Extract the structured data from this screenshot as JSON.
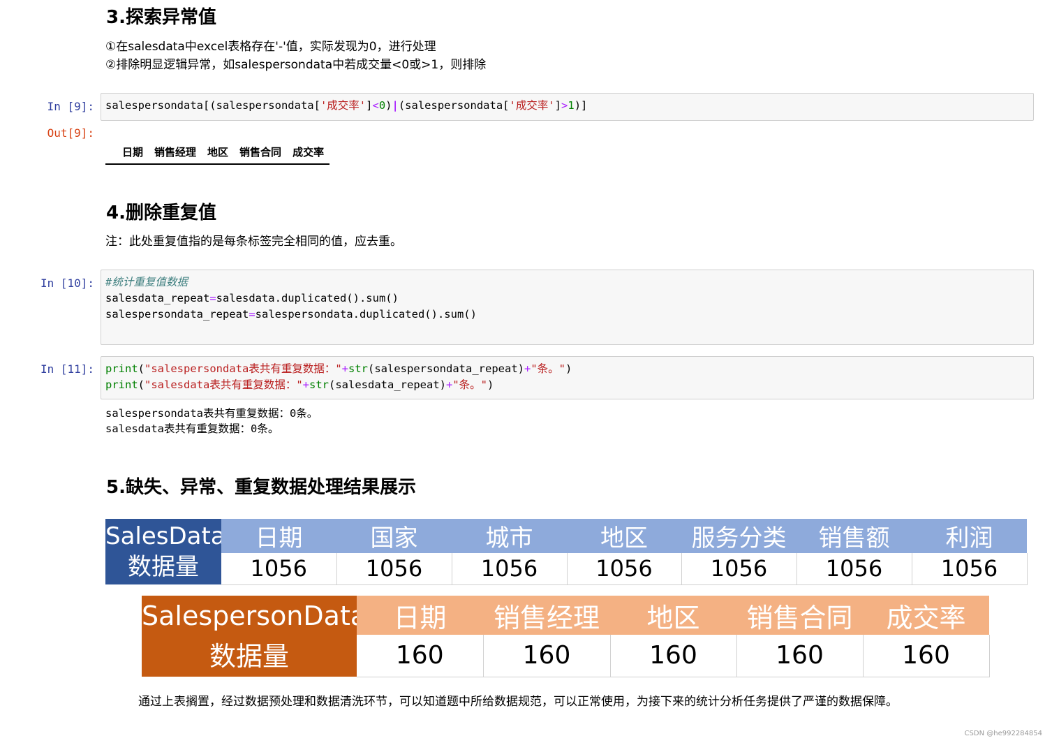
{
  "section3": {
    "title": "3.探索异常值",
    "line1": "①在salesdata中excel表格存在'-'值，实际发现为0，进行处理",
    "line2": "②排除明显逻辑异常，如salespersondata中若成交量<0或>1，则排除"
  },
  "cell9": {
    "in_prompt": "In  [9]:",
    "out_prompt": "Out[9]:",
    "code": {
      "p1": "salespersondata[(salespersondata[",
      "s1": "'成交率'",
      "p2": "]",
      "op1": "<",
      "n1": "0",
      "p3": ")",
      "bar": "|",
      "p4": "(salespersondata[",
      "s2": "'成交率'",
      "p5": "]",
      "op2": ">",
      "n2": "1",
      "p6": ")]"
    },
    "output_columns": [
      "日期",
      "销售经理",
      "地区",
      "销售合同",
      "成交率"
    ]
  },
  "section4": {
    "title": "4.删除重复值",
    "note": "注：此处重复值指的是每条标签完全相同的值，应去重。"
  },
  "cell10": {
    "in_prompt": "In  [10]:",
    "comment": "#统计重复值数据",
    "line2_a": "salesdata_repeat",
    "line2_b": "salesdata.duplicated().sum()",
    "line3_a": "salespersondata_repeat",
    "line3_b": "salespersondata.duplicated().sum()",
    "eq": "="
  },
  "cell11": {
    "in_prompt": "In  [11]:",
    "l1_print": "print",
    "l1_p1": "(",
    "l1_s1": "\"salespersondata表共有重复数据：\"",
    "l1_plus1": "+",
    "l1_str": "str",
    "l1_arg": "(salespersondata_repeat)",
    "l1_plus2": "+",
    "l1_s2": "\"条。\"",
    "l1_p2": ")",
    "l2_print": "print",
    "l2_p1": "(",
    "l2_s1": "\"salesdata表共有重复数据：\"",
    "l2_plus1": "+",
    "l2_str": "str",
    "l2_arg": "(salesdata_repeat)",
    "l2_plus2": "+",
    "l2_s2": "\"条。\"",
    "l2_p2": ")",
    "output1": "salespersondata表共有重复数据：0条。",
    "output2": "salesdata表共有重复数据：0条。"
  },
  "section5": {
    "title": "5.缺失、异常、重复数据处理结果展示",
    "conclusion": "通过上表搁置，经过数据预处理和数据清洗环节，可以知道题中所给数据规范，可以正常使用，为接下来的统计分析任务提供了严谨的数据保障。"
  },
  "salesdata_table": {
    "corner_line1": "SalesData",
    "corner_line2": "数据量",
    "headers": [
      "日期",
      "国家",
      "城市",
      "地区",
      "服务分类",
      "销售额",
      "利润"
    ],
    "values": [
      "1056",
      "1056",
      "1056",
      "1056",
      "1056",
      "1056",
      "1056"
    ]
  },
  "salesperson_table": {
    "corner_line1": "SalespersonData",
    "corner_line2": "数据量",
    "headers": [
      "日期",
      "销售经理",
      "地区",
      "销售合同",
      "成交率"
    ],
    "values": [
      "160",
      "160",
      "160",
      "160",
      "160"
    ]
  },
  "watermark": "CSDN @he992284854",
  "colors": {
    "salesdata_corner": "#2f5597",
    "salesdata_header": "#8eaadb",
    "salesperson_corner": "#c55a11",
    "salesperson_header": "#f4b183",
    "prompt_in": "#303f9f",
    "prompt_out": "#d84315"
  }
}
